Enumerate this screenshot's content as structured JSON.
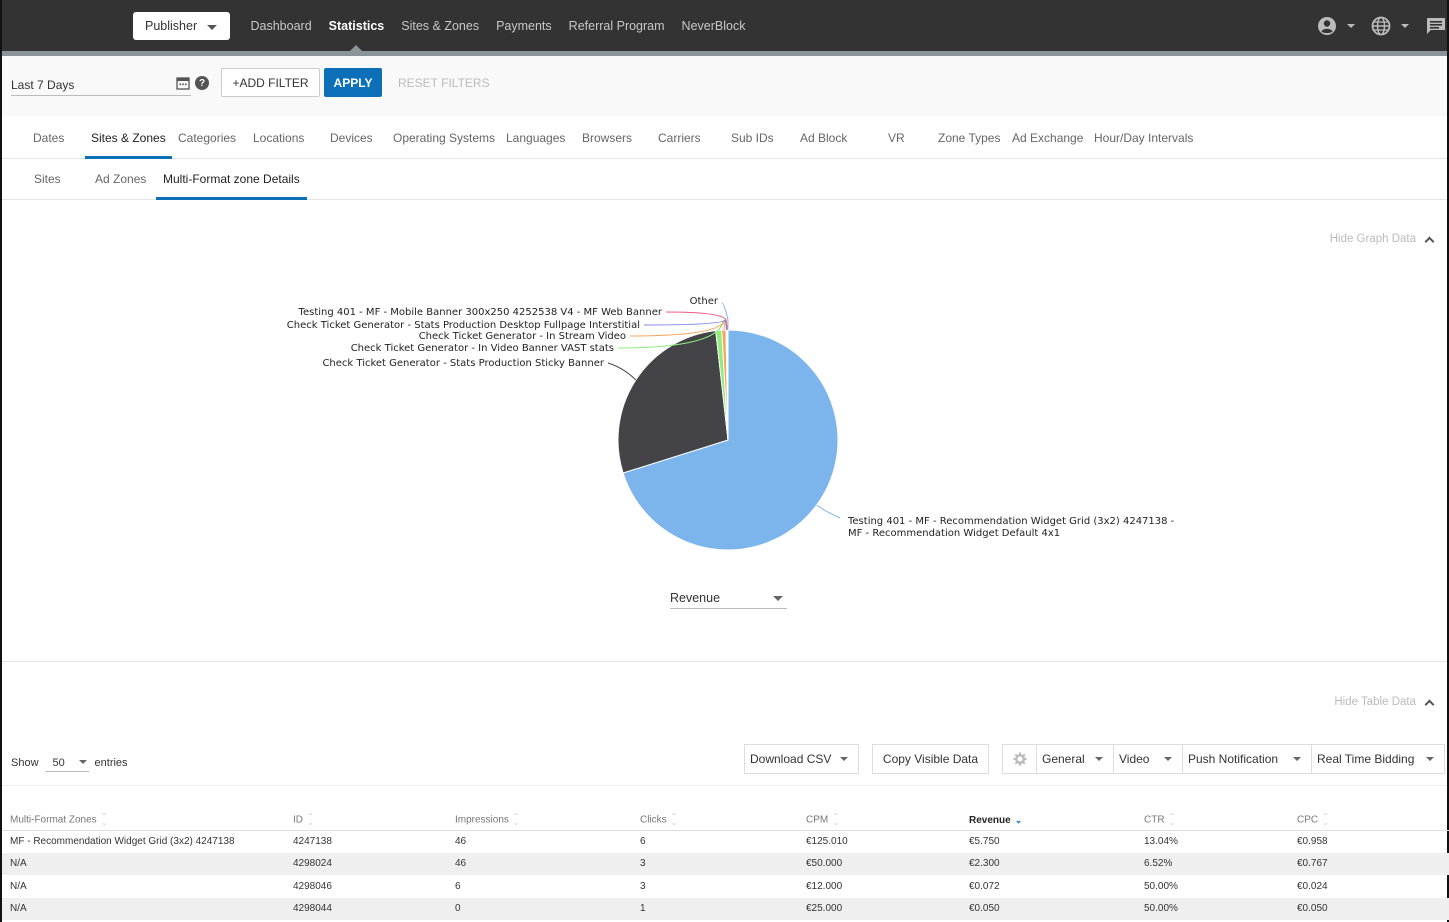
{
  "topnav": {
    "publisher_label": "Publisher",
    "links": [
      {
        "label": "Dashboard",
        "active": false
      },
      {
        "label": "Statistics",
        "active": true
      },
      {
        "label": "Sites & Zones",
        "active": false
      },
      {
        "label": "Payments",
        "active": false
      },
      {
        "label": "Referral Program",
        "active": false
      },
      {
        "label": "NeverBlock",
        "active": false
      }
    ],
    "icons": [
      "account-icon",
      "globe-icon",
      "chat-icon"
    ]
  },
  "filters": {
    "date_range": "Last 7 Days",
    "add_filter_label": "+ADD FILTER",
    "apply_label": "APPLY",
    "reset_label": "RESET FILTERS",
    "help_glyph": "?"
  },
  "main_tabs": [
    {
      "label": "Dates",
      "active": false
    },
    {
      "label": "Sites & Zones",
      "active": true
    },
    {
      "label": "Categories",
      "active": false
    },
    {
      "label": "Locations",
      "active": false
    },
    {
      "label": "Devices",
      "active": false
    },
    {
      "label": "Operating Systems",
      "active": false
    },
    {
      "label": "Languages",
      "active": false
    },
    {
      "label": "Browsers",
      "active": false
    },
    {
      "label": "Carriers",
      "active": false
    },
    {
      "label": "Sub IDs",
      "active": false
    },
    {
      "label": "Ad Block",
      "active": false
    },
    {
      "label": "VR",
      "active": false
    },
    {
      "label": "Zone Types",
      "active": false
    },
    {
      "label": "Ad Exchange",
      "active": false
    },
    {
      "label": "Hour/Day Intervals",
      "active": false
    }
  ],
  "sub_tabs": [
    {
      "label": "Sites",
      "active": false
    },
    {
      "label": "Ad Zones",
      "active": false
    },
    {
      "label": "Multi-Format zone Details",
      "active": true
    }
  ],
  "graph": {
    "hide_label": "Hide Graph Data",
    "metric_select": "Revenue"
  },
  "chart_data": {
    "type": "pie",
    "metric": "Revenue",
    "slices": [
      {
        "label": "Testing 401 - MF - Recommendation Widget Grid (3x2) 4247138 - MF - Recommendation Widget Default 4x1",
        "value": 5.75,
        "color": "#7cb5ec"
      },
      {
        "label": "Check Ticket Generator - Stats Production Sticky Banner",
        "value": 2.3,
        "color": "#434348"
      },
      {
        "label": "Check Ticket Generator - In Video Banner VAST stats",
        "value": 0.072,
        "color": "#90ed7d"
      },
      {
        "label": "Check Ticket Generator - In Stream Video",
        "value": 0.05,
        "color": "#f7a35c"
      },
      {
        "label": "Check Ticket Generator - Stats Production Desktop Fullpage Interstitial",
        "value": 0.012,
        "color": "#8085e9"
      },
      {
        "label": "Testing 401 - MF - Mobile Banner 300x250 4252538 V4 - MF Web Banner",
        "value": 0.008,
        "color": "#f15c80"
      },
      {
        "label": "Other",
        "value": 0.004,
        "color": "#7cb5ec"
      }
    ]
  },
  "table": {
    "hide_label": "Hide Table Data",
    "show_label": "Show",
    "entries_value": "50",
    "entries_label": "entries",
    "download_csv_label": "Download CSV",
    "copy_label": "Copy Visible Data",
    "column_groups": [
      "General",
      "Video",
      "Push Notification",
      "Real Time Bidding"
    ],
    "columns": [
      "Multi-Format Zones",
      "ID",
      "Impressions",
      "Clicks",
      "CPM",
      "Revenue",
      "CTR",
      "CPC"
    ],
    "sorted_column": "Revenue",
    "rows": [
      [
        "MF - Recommendation Widget Grid (3x2) 4247138",
        "4247138",
        "46",
        "6",
        "€125.010",
        "€5.750",
        "13.04%",
        "€0.958"
      ],
      [
        "N/A",
        "4298024",
        "46",
        "3",
        "€50.000",
        "€2.300",
        "6.52%",
        "€0.767"
      ],
      [
        "N/A",
        "4298046",
        "6",
        "3",
        "€12.000",
        "€0.072",
        "50.00%",
        "€0.024"
      ],
      [
        "N/A",
        "4298044",
        "0",
        "1",
        "€25.000",
        "€0.050",
        "50.00%",
        "€0.050"
      ]
    ]
  },
  "colors": {
    "accent": "#0c6fb8",
    "nav_bg": "#333333",
    "nav_strip": "#8a9499"
  }
}
